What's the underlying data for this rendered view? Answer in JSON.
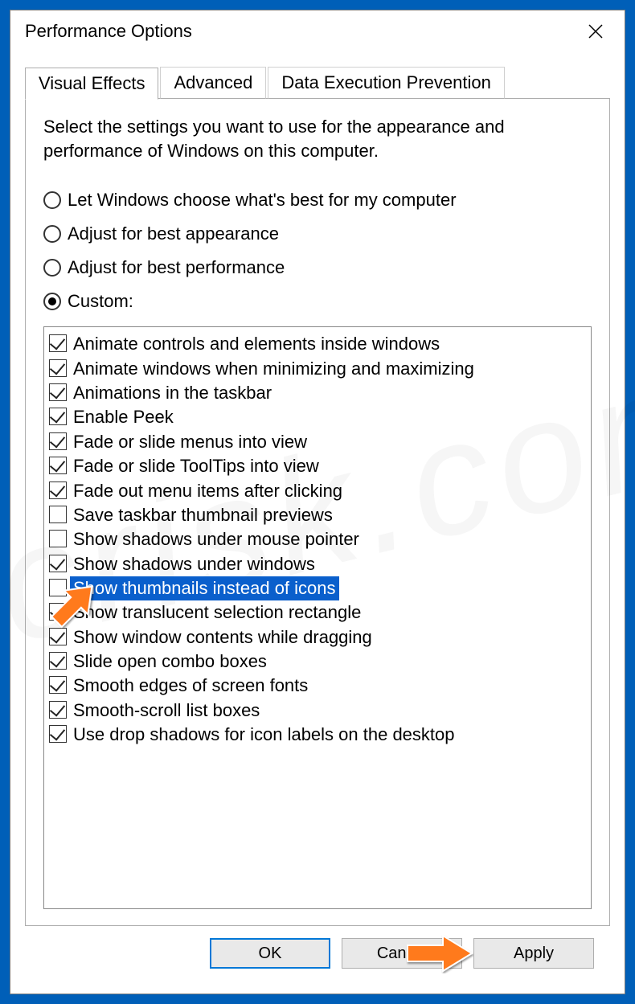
{
  "window": {
    "title": "Performance Options"
  },
  "tabs": [
    {
      "label": "Visual Effects",
      "active": true
    },
    {
      "label": "Advanced",
      "active": false
    },
    {
      "label": "Data Execution Prevention",
      "active": false
    }
  ],
  "intro": "Select the settings you want to use for the appearance and performance of Windows on this computer.",
  "radios": [
    {
      "label": "Let Windows choose what's best for my computer",
      "checked": false
    },
    {
      "label": "Adjust for best appearance",
      "checked": false
    },
    {
      "label": "Adjust for best performance",
      "checked": false
    },
    {
      "label": "Custom:",
      "checked": true
    }
  ],
  "options": [
    {
      "label": "Animate controls and elements inside windows",
      "checked": true,
      "highlight": false
    },
    {
      "label": "Animate windows when minimizing and maximizing",
      "checked": true,
      "highlight": false
    },
    {
      "label": "Animations in the taskbar",
      "checked": true,
      "highlight": false
    },
    {
      "label": "Enable Peek",
      "checked": true,
      "highlight": false
    },
    {
      "label": "Fade or slide menus into view",
      "checked": true,
      "highlight": false
    },
    {
      "label": "Fade or slide ToolTips into view",
      "checked": true,
      "highlight": false
    },
    {
      "label": "Fade out menu items after clicking",
      "checked": true,
      "highlight": false
    },
    {
      "label": "Save taskbar thumbnail previews",
      "checked": false,
      "highlight": false
    },
    {
      "label": "Show shadows under mouse pointer",
      "checked": false,
      "highlight": false
    },
    {
      "label": "Show shadows under windows",
      "checked": true,
      "highlight": false
    },
    {
      "label": "Show thumbnails instead of icons",
      "checked": false,
      "highlight": true
    },
    {
      "label": "Show translucent selection rectangle",
      "checked": true,
      "highlight": false
    },
    {
      "label": "Show window contents while dragging",
      "checked": true,
      "highlight": false
    },
    {
      "label": "Slide open combo boxes",
      "checked": true,
      "highlight": false
    },
    {
      "label": "Smooth edges of screen fonts",
      "checked": true,
      "highlight": false
    },
    {
      "label": "Smooth-scroll list boxes",
      "checked": true,
      "highlight": false
    },
    {
      "label": "Use drop shadows for icon labels on the desktop",
      "checked": true,
      "highlight": false
    }
  ],
  "buttons": {
    "ok": "OK",
    "cancel": "Cancel",
    "apply": "Apply"
  },
  "watermark": "pcrisk.com"
}
